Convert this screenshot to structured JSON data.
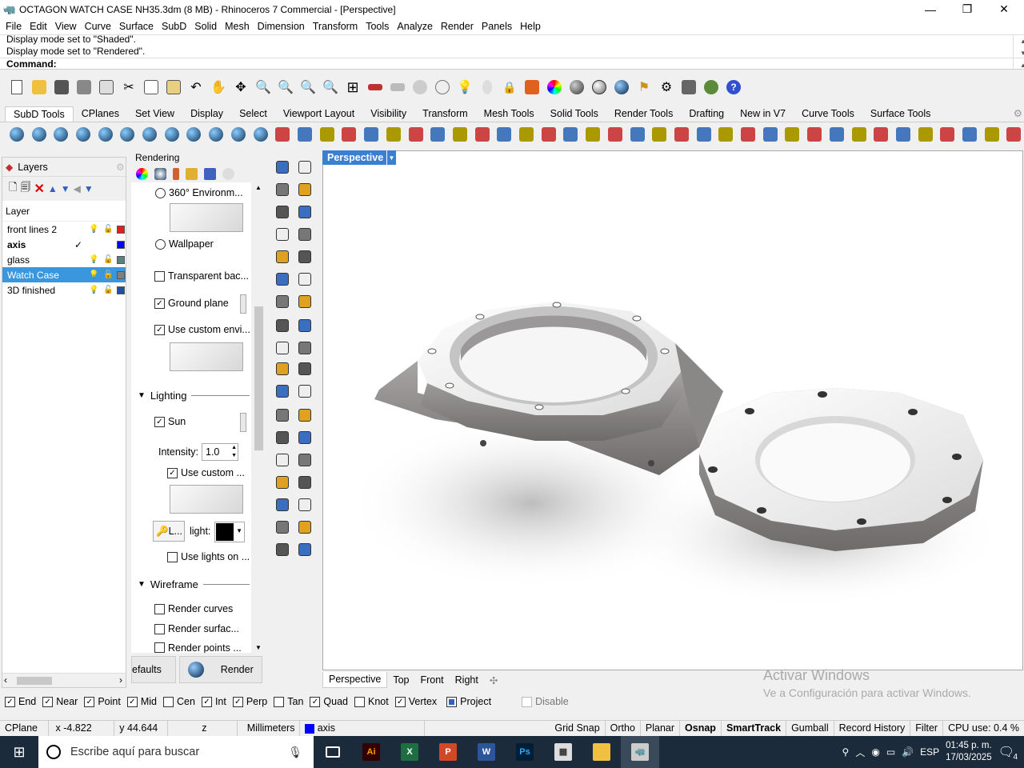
{
  "window": {
    "title": "OCTAGON WATCH CASE NH35.3dm (8 MB) - Rhinoceros 7 Commercial - [Perspective]",
    "minimize": "—",
    "maximize": "❐",
    "close": "✕"
  },
  "menu": [
    "File",
    "Edit",
    "View",
    "Curve",
    "Surface",
    "SubD",
    "Solid",
    "Mesh",
    "Dimension",
    "Transform",
    "Tools",
    "Analyze",
    "Render",
    "Panels",
    "Help"
  ],
  "command": {
    "history1": "Display mode set to \"Shaded\".",
    "history2": "Display mode set to \"Rendered\".",
    "prompt": "Command:"
  },
  "tool_tabs": [
    {
      "label": "SubD Tools",
      "active": true
    },
    {
      "label": "CPlanes"
    },
    {
      "label": "Set View"
    },
    {
      "label": "Display"
    },
    {
      "label": "Select"
    },
    {
      "label": "Viewport Layout"
    },
    {
      "label": "Visibility"
    },
    {
      "label": "Transform"
    },
    {
      "label": "Mesh Tools"
    },
    {
      "label": "Solid Tools"
    },
    {
      "label": "Render Tools"
    },
    {
      "label": "Drafting"
    },
    {
      "label": "New in V7"
    },
    {
      "label": "Curve Tools"
    },
    {
      "label": "Surface Tools"
    }
  ],
  "layers": {
    "title": "Layers",
    "column": "Layer",
    "rows": [
      {
        "name": "front lines 2",
        "color": "#e02020",
        "selected": false,
        "current": false
      },
      {
        "name": "axis",
        "color": "#0000ff",
        "selected": false,
        "current": true,
        "check": "✓"
      },
      {
        "name": "glass",
        "color": "#5a8080",
        "selected": false,
        "current": false
      },
      {
        "name": "Watch Case",
        "color": "#808080",
        "selected": true,
        "current": false
      },
      {
        "name": "3D finished",
        "color": "#2050a0",
        "selected": false,
        "current": false
      }
    ]
  },
  "rendering": {
    "title": "Rendering",
    "env360": "360° Environm...",
    "wallpaper": "Wallpaper",
    "transparent": "Transparent bac...",
    "ground": "Ground plane",
    "custom_env": "Use custom envi...",
    "lighting_header": "Lighting",
    "sun": "Sun",
    "intensity_label": "Intensity:",
    "intensity_value": "1.0",
    "use_custom": "Use custom ...",
    "light_btn": "L...",
    "light_label": "light:",
    "use_lights": "Use lights on ...",
    "wireframe_header": "Wireframe",
    "render_curves": "Render curves",
    "render_surfac": "Render surfac...",
    "render_points": "Render points ...",
    "defaults_btn": "efaults",
    "render_btn": "Render"
  },
  "viewport": {
    "label": "Perspective",
    "tabs": [
      "Perspective",
      "Top",
      "Front",
      "Right"
    ],
    "add_tab": "✣"
  },
  "watermark": {
    "line1": "Activar Windows",
    "line2": "Ve a Configuración para activar Windows."
  },
  "osnaps": [
    {
      "label": "End",
      "on": true
    },
    {
      "label": "Near",
      "on": true
    },
    {
      "label": "Point",
      "on": true
    },
    {
      "label": "Mid",
      "on": true
    },
    {
      "label": "Cen",
      "on": false
    },
    {
      "label": "Int",
      "on": true
    },
    {
      "label": "Perp",
      "on": true
    },
    {
      "label": "Tan",
      "on": false
    },
    {
      "label": "Quad",
      "on": true
    },
    {
      "label": "Knot",
      "on": false
    },
    {
      "label": "Vertex",
      "on": true
    },
    {
      "label": "Project",
      "on": "partial"
    },
    {
      "label": "Disable",
      "on": false,
      "dim": true
    }
  ],
  "status": {
    "cplane": "CPlane",
    "x": "x -4.822",
    "y": "y 44.644",
    "z": "z",
    "units": "Millimeters",
    "layer": "axis",
    "layer_color": "#0000ff",
    "toggles": [
      {
        "label": "Grid Snap",
        "bold": false
      },
      {
        "label": "Ortho",
        "bold": false
      },
      {
        "label": "Planar",
        "bold": false
      },
      {
        "label": "Osnap",
        "bold": true
      },
      {
        "label": "SmartTrack",
        "bold": true
      },
      {
        "label": "Gumball",
        "bold": false
      },
      {
        "label": "Record History",
        "bold": false
      },
      {
        "label": "Filter",
        "bold": false
      }
    ],
    "cpu": "CPU use: 0.4 %"
  },
  "taskbar": {
    "search": "Escribe aquí para buscar",
    "lang": "ESP",
    "time": "01:45 p. m.",
    "date": "17/03/2025",
    "notif": "4"
  }
}
